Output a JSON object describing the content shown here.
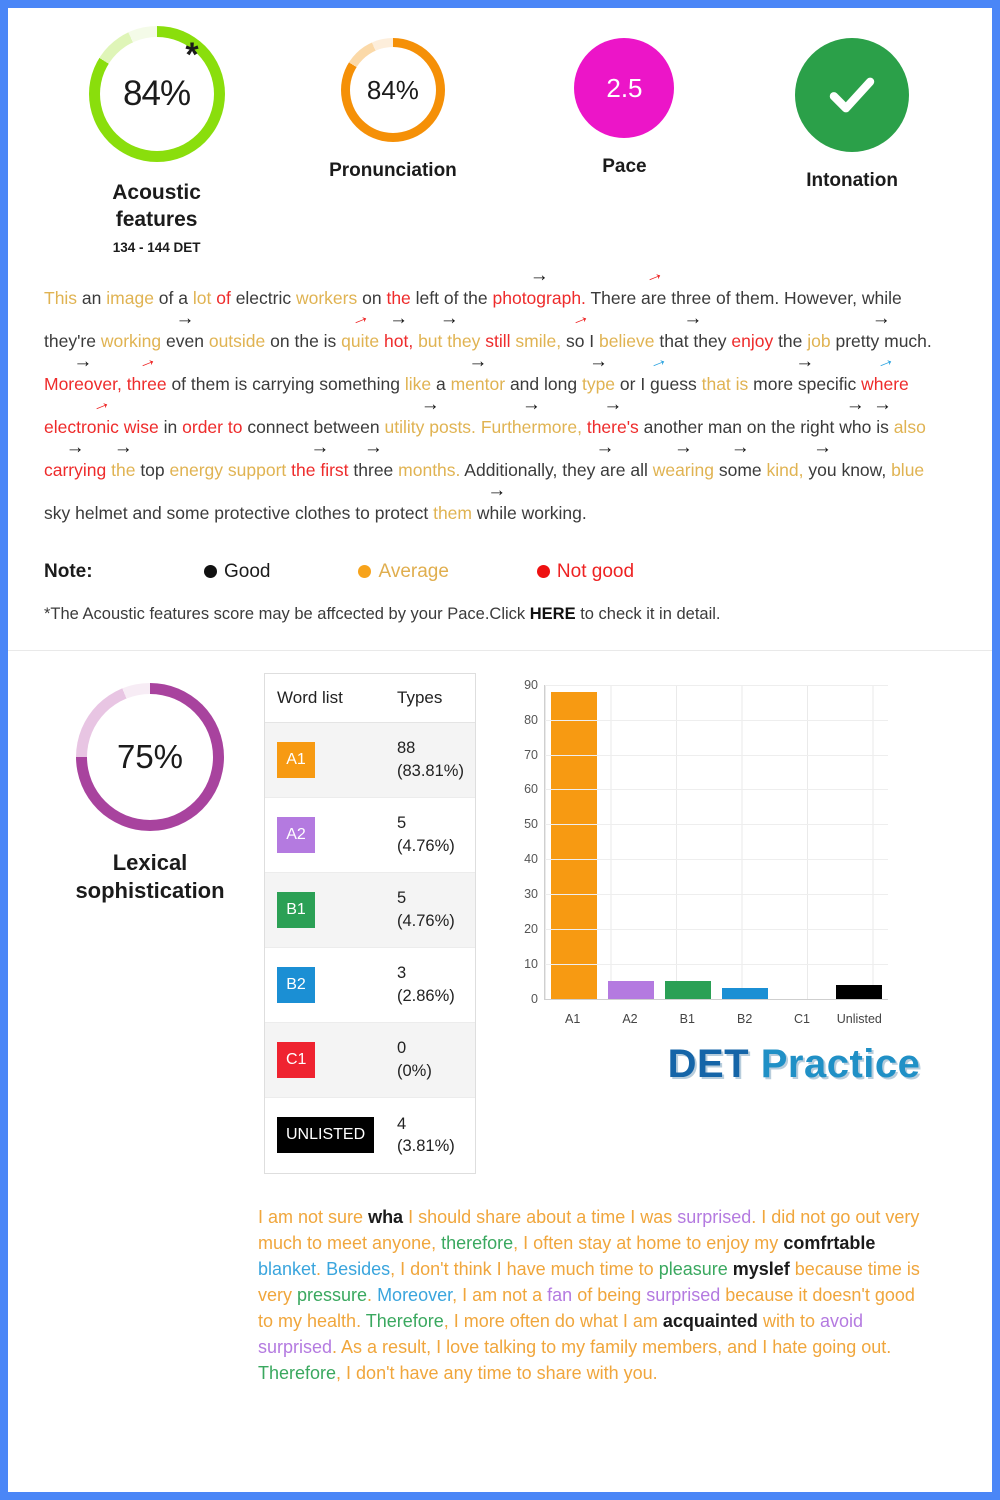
{
  "metrics": [
    {
      "id": "acoustic",
      "value": "84%",
      "label": "Acoustic features",
      "sublabel": "134 - 144 DET",
      "color": "#8ade0c",
      "has_star": true,
      "star": "*"
    },
    {
      "id": "pronunciation",
      "value": "84%",
      "label": "Pronunciation",
      "color": "#f59007"
    },
    {
      "id": "pace",
      "value": "2.5",
      "label": "Pace",
      "color": "#ec15c8"
    },
    {
      "id": "intonation",
      "value": "",
      "label": "Intonation",
      "color": "#2ba049",
      "icon": "check-icon"
    }
  ],
  "transcript": [
    [
      {
        "t": "This",
        "c": "org"
      },
      {
        "t": " an ",
        "c": "black"
      },
      {
        "t": "image",
        "c": "org"
      },
      {
        "t": " of a ",
        "c": "black"
      },
      {
        "t": "lot",
        "c": "org"
      },
      {
        "t": " ",
        "c": "black"
      },
      {
        "t": "of",
        "c": "red"
      },
      {
        "t": " electric ",
        "c": "black"
      },
      {
        "t": "workers",
        "c": "org"
      },
      {
        "t": " on ",
        "c": "black"
      },
      {
        "t": "the",
        "c": "red"
      },
      {
        "t": " left of the ",
        "c": "black"
      },
      {
        "t": "photograph.",
        "c": "red",
        "a": "black"
      },
      {
        "t": " There",
        "c": "black"
      },
      {
        "t": " are ",
        "c": "black",
        "a": "red"
      },
      {
        "t": "three of them. However,",
        "c": "black"
      },
      {
        "t": " while",
        "c": "black"
      }
    ],
    [
      {
        "t": "they're ",
        "c": "black"
      },
      {
        "t": "working",
        "c": "org"
      },
      {
        "t": " even ",
        "c": "black",
        "a": "black"
      },
      {
        "t": "outside",
        "c": "org"
      },
      {
        "t": " on the is ",
        "c": "black"
      },
      {
        "t": "quite",
        "c": "org",
        "a": "red"
      },
      {
        "t": " ",
        "c": "black"
      },
      {
        "t": "hot,",
        "c": "red",
        "a": "black"
      },
      {
        "t": " ",
        "c": "black"
      },
      {
        "t": "but they",
        "c": "org",
        "a": "black"
      },
      {
        "t": " ",
        "c": "black"
      },
      {
        "t": "still",
        "c": "red"
      },
      {
        "t": " ",
        "c": "black"
      },
      {
        "t": "smile,",
        "c": "org"
      },
      {
        "t": " so I ",
        "c": "black",
        "a": "red"
      },
      {
        "t": "believe",
        "c": "org"
      },
      {
        "t": " that they ",
        "c": "black",
        "a": "black"
      },
      {
        "t": "enjoy",
        "c": "red"
      },
      {
        "t": " the ",
        "c": "black"
      },
      {
        "t": "job",
        "c": "org"
      },
      {
        "t": " pretty much.",
        "c": "black",
        "a": "black"
      }
    ],
    [
      {
        "t": "Moreover,",
        "c": "red",
        "a": "black"
      },
      {
        "t": " ",
        "c": "black"
      },
      {
        "t": "three",
        "c": "red",
        "a": "red"
      },
      {
        "t": " of them is carrying something ",
        "c": "black"
      },
      {
        "t": "like",
        "c": "org"
      },
      {
        "t": " a ",
        "c": "black"
      },
      {
        "t": "mentor",
        "c": "org",
        "a": "black"
      },
      {
        "t": " and long ",
        "c": "black"
      },
      {
        "t": "type",
        "c": "org",
        "a": "black"
      },
      {
        "t": " or I guess ",
        "c": "black",
        "a": "blue"
      },
      {
        "t": "that is",
        "c": "org"
      },
      {
        "t": " more specific ",
        "c": "black",
        "a": "black"
      },
      {
        "t": "where",
        "c": "red",
        "a": "blue"
      }
    ],
    [
      {
        "t": "electronic wise",
        "c": "red",
        "a": "red"
      },
      {
        "t": " in ",
        "c": "black"
      },
      {
        "t": "order to",
        "c": "red"
      },
      {
        "t": " connect between ",
        "c": "black"
      },
      {
        "t": "utility posts.",
        "c": "org",
        "a": "black"
      },
      {
        "t": " ",
        "c": "black"
      },
      {
        "t": "Furthermore,",
        "c": "org",
        "a": "black"
      },
      {
        "t": " ",
        "c": "black"
      },
      {
        "t": "there's",
        "c": "red",
        "a": "black"
      },
      {
        "t": " another man on the right ",
        "c": "black"
      },
      {
        "t": "who",
        "c": "black",
        "a": "black"
      },
      {
        "t": " is ",
        "c": "black",
        "a": "black"
      },
      {
        "t": "also",
        "c": "org"
      }
    ],
    [
      {
        "t": "carrying",
        "c": "red",
        "a": "black"
      },
      {
        "t": " ",
        "c": "black"
      },
      {
        "t": "the",
        "c": "org",
        "a": "black"
      },
      {
        "t": " top ",
        "c": "black"
      },
      {
        "t": "energy support",
        "c": "org"
      },
      {
        "t": " ",
        "c": "black"
      },
      {
        "t": "the first",
        "c": "red",
        "a": "black"
      },
      {
        "t": " three ",
        "c": "black",
        "a": "black"
      },
      {
        "t": "months.",
        "c": "org"
      },
      {
        "t": " Additionally,",
        "c": "black"
      },
      {
        "t": " they are all ",
        "c": "black",
        "a": "black"
      },
      {
        "t": "wearing",
        "c": "org",
        "a": "black"
      },
      {
        "t": " some ",
        "c": "black",
        "a": "black"
      },
      {
        "t": "kind,",
        "c": "org"
      },
      {
        "t": " you ",
        "c": "black",
        "a": "black"
      },
      {
        "t": "know,",
        "c": "black"
      },
      {
        "t": " ",
        "c": "black"
      },
      {
        "t": "blue",
        "c": "org"
      }
    ],
    [
      {
        "t": "sky helmet and some protective clothes to protect ",
        "c": "black"
      },
      {
        "t": "them",
        "c": "org"
      },
      {
        "t": " while ",
        "c": "black",
        "a": "black"
      },
      {
        "t": "working.",
        "c": "black"
      }
    ]
  ],
  "note": {
    "label": "Note:",
    "items": [
      {
        "text": "Good",
        "dot": "#111111",
        "color": "#1b1b1b"
      },
      {
        "text": "Average",
        "dot": "#f7a31b",
        "color": "#e0ae4e"
      },
      {
        "text": "Not good",
        "dot": "#ee1111",
        "color": "#ee2222"
      }
    ]
  },
  "footnote": {
    "pre": "*The Acoustic features score may be affcected by your Pace.Click ",
    "link": "HERE",
    "post": " to check it in detail."
  },
  "lexical": {
    "value": "75%",
    "label": "Lexical sophistication",
    "ring_color": "#a8439e"
  },
  "word_list": {
    "headers": [
      "Word list",
      "Types"
    ],
    "rows": [
      {
        "level": "A1",
        "color": "#f79a12",
        "count": "88",
        "pct": "(83.81%)"
      },
      {
        "level": "A2",
        "color": "#b47ae0",
        "count": "5",
        "pct": "(4.76%)"
      },
      {
        "level": "B1",
        "color": "#2ba055",
        "count": "5",
        "pct": "(4.76%)"
      },
      {
        "level": "B2",
        "color": "#1b8fd4",
        "count": "3",
        "pct": "(2.86%)"
      },
      {
        "level": "C1",
        "color": "#ef2330",
        "count": "0",
        "pct": "(0%)"
      },
      {
        "level": "UNLISTED",
        "color": "#000000",
        "count": "4",
        "pct": "(3.81%)"
      }
    ]
  },
  "chart_data": {
    "type": "bar",
    "title": "",
    "xlabel": "",
    "ylabel": "",
    "categories": [
      "A1",
      "A2",
      "B1",
      "B2",
      "C1",
      "Unlisted"
    ],
    "values": [
      88,
      5,
      5,
      3,
      0,
      4
    ],
    "colors": [
      "#f79a12",
      "#b47ae0",
      "#2ba055",
      "#1b8fd4",
      "#ef2330",
      "#000000"
    ],
    "ylim": [
      0,
      90
    ],
    "yticks": [
      0,
      10,
      20,
      30,
      40,
      50,
      60,
      70,
      80,
      90
    ],
    "grid": true,
    "legend": "none"
  },
  "logo": {
    "part1": "DET",
    "part2": "Practice"
  },
  "essay": [
    {
      "t": "I am not sure ",
      "c": "org"
    },
    {
      "t": "wha",
      "c": "blk"
    },
    {
      "t": " I should share about a time I was ",
      "c": "org"
    },
    {
      "t": "surprised",
      "c": "pur"
    },
    {
      "t": ". I did not go out very much to meet anyone",
      "c": "org"
    },
    {
      "t": ", ",
      "c": "org"
    },
    {
      "t": "therefore",
      "c": "grn"
    },
    {
      "t": ", I often stay at home to enjoy my ",
      "c": "org"
    },
    {
      "t": "comfrtable",
      "c": "blk"
    },
    {
      "t": " ",
      "c": "org"
    },
    {
      "t": "blanket",
      "c": "blu"
    },
    {
      "t": ". ",
      "c": "org"
    },
    {
      "t": "Besides",
      "c": "blu"
    },
    {
      "t": ", I don't think I have much time to ",
      "c": "org"
    },
    {
      "t": "pleasure",
      "c": "grn"
    },
    {
      "t": " ",
      "c": "org"
    },
    {
      "t": "myslef",
      "c": "blk"
    },
    {
      "t": " because time is very ",
      "c": "org"
    },
    {
      "t": "pressure",
      "c": "grn"
    },
    {
      "t": ". ",
      "c": "org"
    },
    {
      "t": "Moreover",
      "c": "blu"
    },
    {
      "t": ", I am not a ",
      "c": "org"
    },
    {
      "t": "fan",
      "c": "pur"
    },
    {
      "t": " of being ",
      "c": "org"
    },
    {
      "t": "surprised",
      "c": "pur"
    },
    {
      "t": " because it doesn't good to my health",
      "c": "org"
    },
    {
      "t": ". ",
      "c": "org"
    },
    {
      "t": "Therefore",
      "c": "grn"
    },
    {
      "t": ", I more often do what I am ",
      "c": "org"
    },
    {
      "t": "acquainted",
      "c": "blk"
    },
    {
      "t": " with to ",
      "c": "org"
    },
    {
      "t": "avoid",
      "c": "pur"
    },
    {
      "t": " ",
      "c": "org"
    },
    {
      "t": "surprised",
      "c": "pur"
    },
    {
      "t": ". As a result, I love talking to my family members, and I hate going out",
      "c": "org"
    },
    {
      "t": ". ",
      "c": "org"
    },
    {
      "t": "Therefore",
      "c": "grn"
    },
    {
      "t": ", I don't have any time to share with you.",
      "c": "org"
    }
  ]
}
